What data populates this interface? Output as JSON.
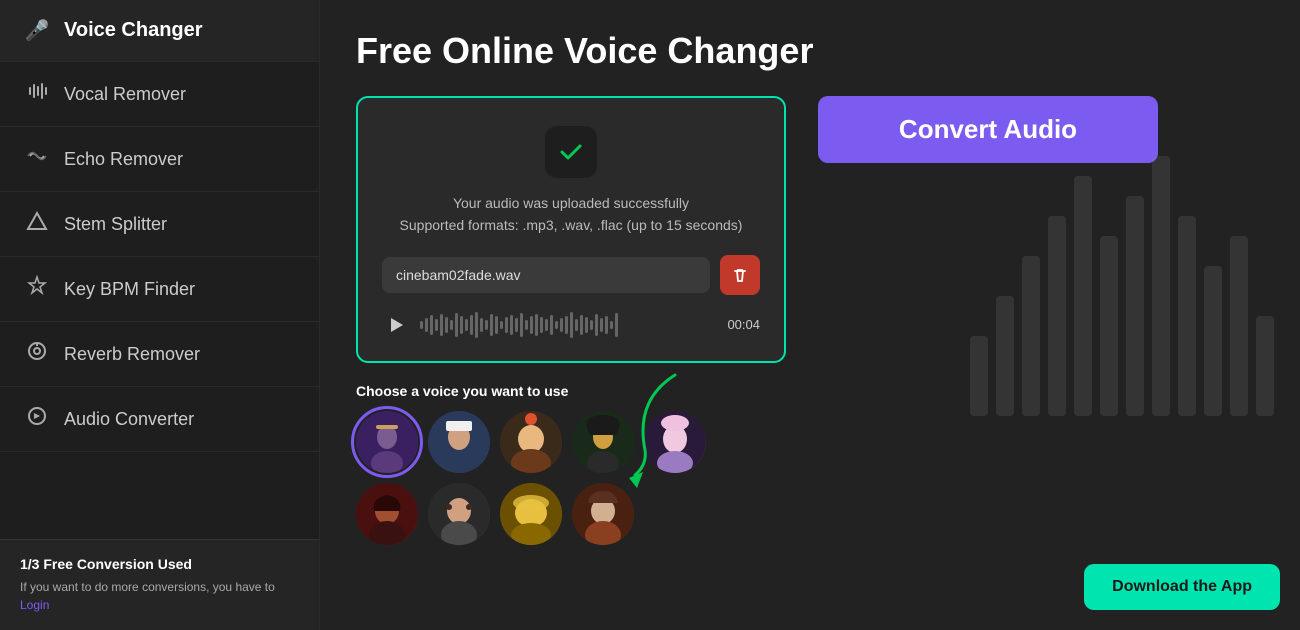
{
  "sidebar": {
    "items": [
      {
        "id": "voice-changer",
        "label": "Voice Changer",
        "icon": "🎤"
      },
      {
        "id": "vocal-remover",
        "label": "Vocal Remover",
        "icon": "🎚"
      },
      {
        "id": "echo-remover",
        "label": "Echo Remover",
        "icon": "〰"
      },
      {
        "id": "stem-splitter",
        "label": "Stem Splitter",
        "icon": "△"
      },
      {
        "id": "key-bpm-finder",
        "label": "Key BPM Finder",
        "icon": "🔔"
      },
      {
        "id": "reverb-remover",
        "label": "Reverb Remover",
        "icon": "⚙"
      },
      {
        "id": "audio-converter",
        "label": "Audio Converter",
        "icon": "🔄"
      }
    ],
    "footer": {
      "title": "1/3 Free Conversion Used",
      "desc": "If you want to do more conversions, you have to ",
      "login_text": "Login"
    }
  },
  "main": {
    "page_title": "Free Online Voice Changer",
    "upload_box": {
      "success_message": "Your audio was uploaded successfully",
      "supported_formats": "Supported formats: .mp3, .wav, .flac (up to 15 seconds)",
      "file_name": "cinebam02fade.wav",
      "duration": "00:04"
    },
    "voice_section": {
      "label": "Choose a voice you want to use"
    },
    "convert_button": "Convert Audio",
    "download_button": "Download the App"
  },
  "colors": {
    "accent_teal": "#00e5b0",
    "accent_purple": "#7c5cf0",
    "delete_red": "#c0392b"
  }
}
